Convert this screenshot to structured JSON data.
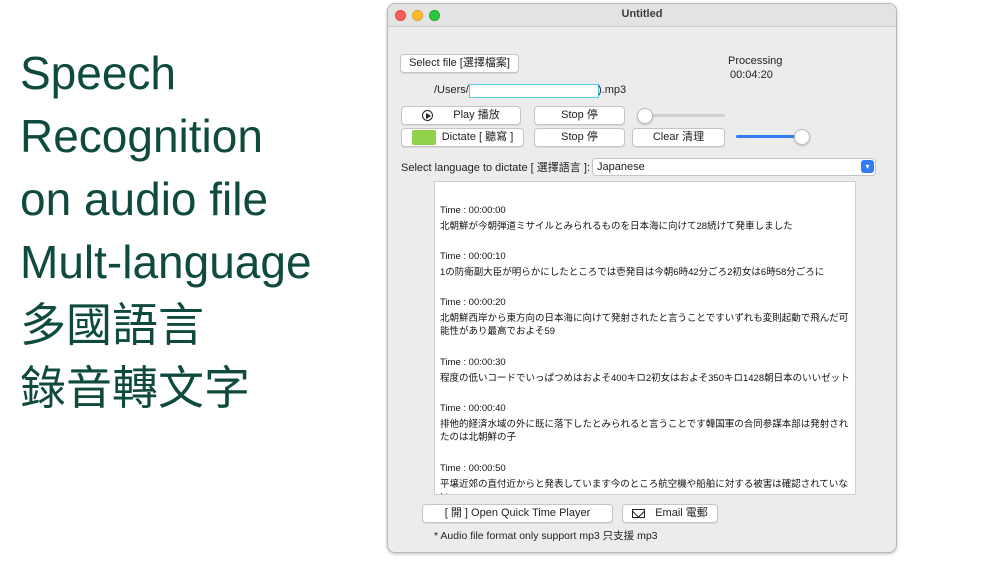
{
  "slide": {
    "title_lines": [
      "Speech",
      "Recognition",
      "on audio file",
      "Mult-language",
      "多國語言",
      "錄音轉文字"
    ]
  },
  "window": {
    "title": "Untitled",
    "select_file_label": "Select file [選擇檔案]",
    "processing_label": "Processing",
    "processing_time": "00:04:20",
    "path_prefix": "/Users/",
    "path_suffix": ").mp3",
    "play_label": "Play 播放",
    "stop_label_1": "Stop 停",
    "dictate_label": "Dictate [ 聽寫 ]",
    "stop_label_2": "Stop 停",
    "clear_label": "Clear 清理",
    "language_prompt": "Select language to dictate [ 選擇語言 ]:",
    "language_value": "Japanese",
    "play_slider_level": 0.03,
    "volume_slider_level": 0.9,
    "transcript": [
      {
        "time": "Time : 00:00:00",
        "text": "北朝鮮が今朝弾道ミサイルとみられるものを日本海に向けて28続けて発車しました"
      },
      {
        "time": "Time : 00:00:10",
        "text": "1の防衛副大臣が明らかにしたところでは壱発目は今朝6時42分ごろ2初女は6時58分ごろに"
      },
      {
        "time": "Time : 00:00:20",
        "text": "北朝鮮西岸から東方向の日本海に向けて発射されたと言うことですいずれも変則起動で飛んだ可能性があり最高でおよそ59"
      },
      {
        "time": "Time : 00:00:30",
        "text": "程度の低いコードでいっぱつめはおよそ400キロ2初女はおよそ350キロ1428朝日本のいいゼット"
      },
      {
        "time": "Time : 00:00:40",
        "text": "排他的経済水域の外に既に落下したとみられると言うことです韓国軍の合同参謀本部は発射されたのは北朝鮮の子"
      },
      {
        "time": "Time : 00:00:50",
        "text": "平壌近郊の直付近からと発表しています今のところ航空機や船舶に対する被害は確認されていない"
      }
    ],
    "open_player_label": "[ 開 ] Open Quick Time Player",
    "email_label": "Email 電郵",
    "note": "* Audio file format only support mp3  只支援 mp3"
  },
  "icons": {
    "play": "play-circle-icon",
    "dictate": "headphones-icon",
    "email": "envelope-icon",
    "dropdown": "chevron-updown-icon"
  },
  "colors": {
    "slide_title": "#0f4a3f",
    "accent": "#2f7cf6",
    "dictate_icon_bg": "#8fd24a",
    "path_field_border": "#4fd0e8"
  }
}
